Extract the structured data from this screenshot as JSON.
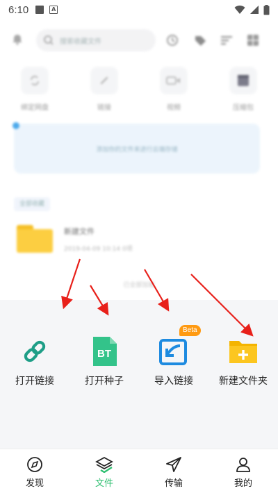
{
  "status_bar": {
    "time": "6:10",
    "notif_letter": "A"
  },
  "background": {
    "search_placeholder": "搜索收藏文件",
    "shortcuts": [
      {
        "label": "绑定网盘"
      },
      {
        "label": "链接"
      },
      {
        "label": "视频"
      },
      {
        "label": "压缩包"
      }
    ],
    "upload_hint": "添加你的文件来进行云端存储",
    "recent_label": "全部收藏",
    "folder": {
      "name": "新建文件",
      "meta": "2019-04-09 10:14    0项"
    },
    "loaded_text": "已全部加载"
  },
  "sheet": {
    "actions": [
      {
        "label": "打开链接",
        "icon": "link-icon"
      },
      {
        "label": "打开种子",
        "icon": "bt-torrent-icon",
        "icon_text": "BT"
      },
      {
        "label": "导入链接",
        "icon": "import-link-icon",
        "badge": "Beta"
      },
      {
        "label": "新建文件夹",
        "icon": "new-folder-icon"
      }
    ]
  },
  "bottom_nav": [
    {
      "label": "发现",
      "icon": "compass-icon",
      "active": false
    },
    {
      "label": "文件",
      "icon": "layers-icon",
      "active": true
    },
    {
      "label": "传输",
      "icon": "paper-plane-icon",
      "active": false
    },
    {
      "label": "我的",
      "icon": "user-icon",
      "active": false
    }
  ],
  "colors": {
    "accent": "#2fbf71",
    "teal": "#1e9e87",
    "blue": "#1e8be0",
    "orange": "#ff9a12",
    "folder_yellow": "#fcc620",
    "arrow_red": "#e8201a"
  }
}
